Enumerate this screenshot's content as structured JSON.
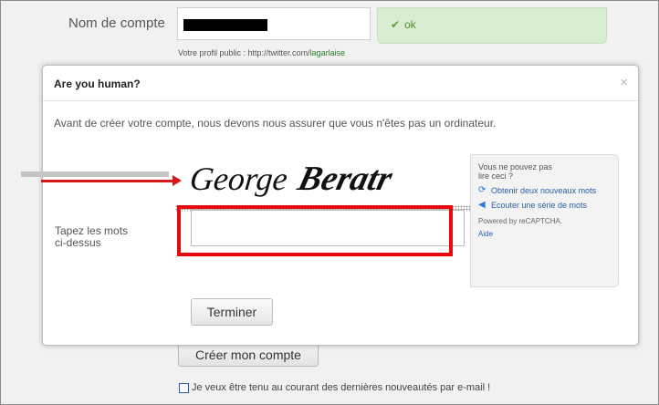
{
  "background_form": {
    "account_label": "Nom de compte",
    "ok_text": "ok",
    "profile_prefix": "Votre profil public : http://twitter.com/",
    "profile_handle": "lagarlaise",
    "create_button": "Créer mon compte",
    "newsletter_label": "Je veux être tenu au courant des dernières nouveautés par e-mail !"
  },
  "modal": {
    "title": "Are you human?",
    "close_label": "×",
    "intro": "Avant de créer votre compte, nous devons nous assurer que vous n'êtes pas un ordinateur.",
    "input_label_line1": "Tapez les mots",
    "input_label_line2": "ci-dessus",
    "captcha_words": [
      "George",
      "Beratr"
    ],
    "captcha_value": "",
    "submit_label": "Terminer"
  },
  "recaptcha": {
    "cant_read": "Vous ne pouvez pas lire ceci ?",
    "refresh_label": "Obtenir deux nouveaux mots",
    "audio_label": "Ecouter une série de mots",
    "powered_by": "Powered by reCAPTCHA.",
    "help_label": "Aide"
  },
  "icons": {
    "ok": "check-icon",
    "refresh": "refresh-icon",
    "audio": "speaker-icon",
    "close": "close-icon"
  },
  "colors": {
    "annotation_red": "#e8090c",
    "ok_green": "#4f8f3b",
    "link_blue": "#2a5ea7"
  }
}
